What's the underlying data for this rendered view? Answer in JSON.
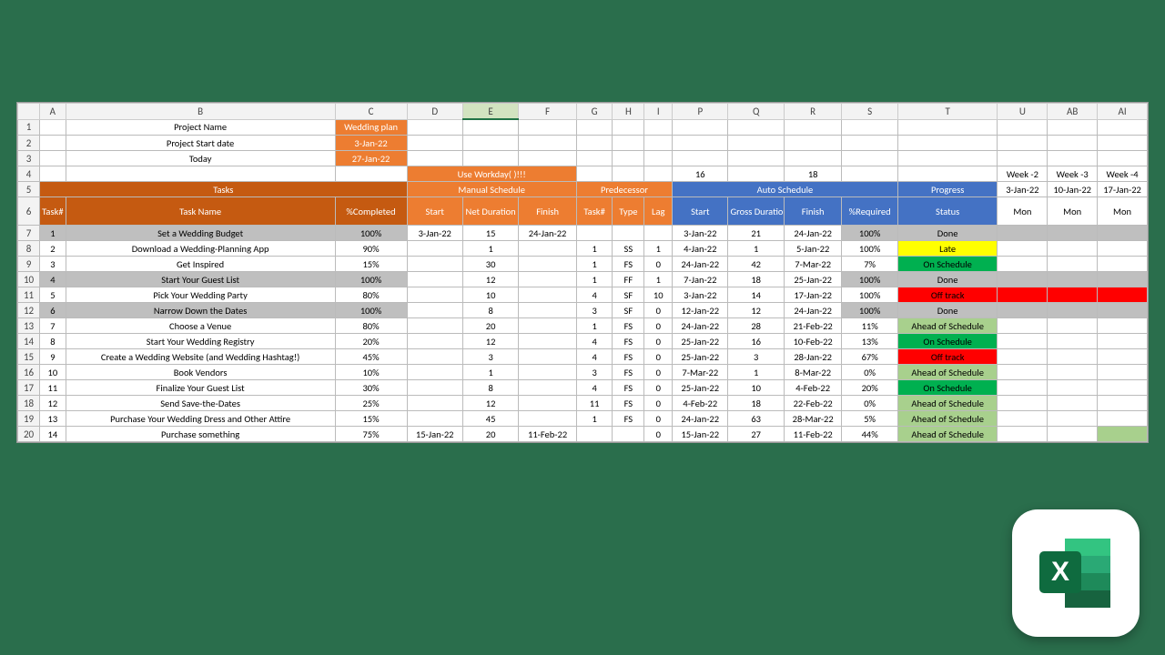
{
  "cols": [
    "A",
    "B",
    "C",
    "D",
    "E",
    "F",
    "G",
    "H",
    "I",
    "P",
    "Q",
    "R",
    "S",
    "T",
    "U",
    "AB",
    "AI"
  ],
  "meta": {
    "r1": {
      "label": "Project Name",
      "val": "Wedding plan"
    },
    "r2": {
      "label": "Project Start date",
      "val": "3-Jan-22"
    },
    "r3": {
      "label": "Today",
      "val": "27-Jan-22"
    }
  },
  "row4": {
    "useworkday": "Use Workday( )!!!",
    "n16": "16",
    "n18": "18",
    "w2": "Week -2",
    "w3": "Week -3",
    "w4": "Week -4"
  },
  "row5": {
    "tasks": "Tasks",
    "manual": "Manual Schedule",
    "pred": "Predecessor",
    "auto": "Auto Schedule",
    "prog": "Progress",
    "d1": "3-Jan-22",
    "d2": "10-Jan-22",
    "d3": "17-Jan-22"
  },
  "hdr": {
    "tnum": "Task#",
    "tname": "Task Name",
    "comp": "%Completed",
    "start": "Start",
    "net": "Net Duration",
    "fin": "Finish",
    "ptnum": "Task#",
    "type": "Type",
    "lag": "Lag",
    "astart": "Start",
    "gross": "Gross Duration",
    "afin": "Finish",
    "req": "%Required",
    "stat": "Status",
    "mon": "Mon"
  },
  "rows": [
    {
      "n": "1",
      "name": "Set a Wedding Budget",
      "comp": "100%",
      "start": "3-Jan-22",
      "net": "15",
      "fin": "24-Jan-22",
      "pt": "",
      "ty": "",
      "lag": "",
      "as": "3-Jan-22",
      "gd": "21",
      "af": "24-Jan-22",
      "req": "100%",
      "stat": "Done",
      "sc": "gray",
      "gr": true
    },
    {
      "n": "2",
      "name": "Download a Wedding-Planning App",
      "comp": "90%",
      "start": "",
      "net": "1",
      "fin": "",
      "pt": "1",
      "ty": "SS",
      "lag": "1",
      "as": "4-Jan-22",
      "gd": "1",
      "af": "5-Jan-22",
      "req": "100%",
      "stat": "Late",
      "sc": "yellow"
    },
    {
      "n": "3",
      "name": "Get Inspired",
      "comp": "15%",
      "start": "",
      "net": "30",
      "fin": "",
      "pt": "1",
      "ty": "FS",
      "lag": "0",
      "as": "24-Jan-22",
      "gd": "42",
      "af": "7-Mar-22",
      "req": "7%",
      "stat": "On Schedule",
      "sc": "green"
    },
    {
      "n": "4",
      "name": "Start Your Guest List",
      "comp": "100%",
      "start": "",
      "net": "12",
      "fin": "",
      "pt": "1",
      "ty": "FF",
      "lag": "1",
      "as": "7-Jan-22",
      "gd": "18",
      "af": "25-Jan-22",
      "req": "100%",
      "stat": "Done",
      "sc": "gray",
      "gr": true
    },
    {
      "n": "5",
      "name": "Pick Your Wedding Party",
      "comp": "80%",
      "start": "",
      "net": "10",
      "fin": "",
      "pt": "4",
      "ty": "SF",
      "lag": "10",
      "as": "3-Jan-22",
      "gd": "14",
      "af": "17-Jan-22",
      "req": "100%",
      "stat": "Off track",
      "sc": "red",
      "week": true
    },
    {
      "n": "6",
      "name": "Narrow Down the Dates",
      "comp": "100%",
      "start": "",
      "net": "8",
      "fin": "",
      "pt": "3",
      "ty": "SF",
      "lag": "0",
      "as": "12-Jan-22",
      "gd": "12",
      "af": "24-Jan-22",
      "req": "100%",
      "stat": "Done",
      "sc": "gray",
      "gr": true
    },
    {
      "n": "7",
      "name": "Choose a Venue",
      "comp": "80%",
      "start": "",
      "net": "20",
      "fin": "",
      "pt": "1",
      "ty": "FS",
      "lag": "0",
      "as": "24-Jan-22",
      "gd": "28",
      "af": "21-Feb-22",
      "req": "11%",
      "stat": "Ahead of Schedule",
      "sc": "olive"
    },
    {
      "n": "8",
      "name": "Start Your Wedding Registry",
      "comp": "20%",
      "start": "",
      "net": "12",
      "fin": "",
      "pt": "4",
      "ty": "FS",
      "lag": "0",
      "as": "25-Jan-22",
      "gd": "16",
      "af": "10-Feb-22",
      "req": "13%",
      "stat": "On Schedule",
      "sc": "green"
    },
    {
      "n": "9",
      "name": "Create a Wedding Website (and Wedding Hashtag!)",
      "comp": "45%",
      "start": "",
      "net": "3",
      "fin": "",
      "pt": "4",
      "ty": "FS",
      "lag": "0",
      "as": "25-Jan-22",
      "gd": "3",
      "af": "28-Jan-22",
      "req": "67%",
      "stat": "Off track",
      "sc": "red"
    },
    {
      "n": "10",
      "name": "Book Vendors",
      "comp": "10%",
      "start": "",
      "net": "1",
      "fin": "",
      "pt": "3",
      "ty": "FS",
      "lag": "0",
      "as": "7-Mar-22",
      "gd": "1",
      "af": "8-Mar-22",
      "req": "0%",
      "stat": "Ahead of Schedule",
      "sc": "olive"
    },
    {
      "n": "11",
      "name": "Finalize Your Guest List",
      "comp": "30%",
      "start": "",
      "net": "8",
      "fin": "",
      "pt": "4",
      "ty": "FS",
      "lag": "0",
      "as": "25-Jan-22",
      "gd": "10",
      "af": "4-Feb-22",
      "req": "20%",
      "stat": "On Schedule",
      "sc": "green"
    },
    {
      "n": "12",
      "name": "Send Save-the-Dates",
      "comp": "25%",
      "start": "",
      "net": "12",
      "fin": "",
      "pt": "11",
      "ty": "FS",
      "lag": "0",
      "as": "4-Feb-22",
      "gd": "18",
      "af": "22-Feb-22",
      "req": "0%",
      "stat": "Ahead of Schedule",
      "sc": "olive"
    },
    {
      "n": "13",
      "name": "Purchase Your Wedding Dress and Other Attire",
      "comp": "15%",
      "start": "",
      "net": "45",
      "fin": "",
      "pt": "1",
      "ty": "FS",
      "lag": "0",
      "as": "24-Jan-22",
      "gd": "63",
      "af": "28-Mar-22",
      "req": "5%",
      "stat": "Ahead of Schedule",
      "sc": "olive"
    },
    {
      "n": "14",
      "name": "Purchase something",
      "comp": "75%",
      "start": "15-Jan-22",
      "net": "20",
      "fin": "11-Feb-22",
      "pt": "",
      "ty": "",
      "lag": "0",
      "as": "15-Jan-22",
      "gd": "27",
      "af": "11-Feb-22",
      "req": "44%",
      "stat": "Ahead of Schedule",
      "sc": "olive",
      "last": true
    }
  ]
}
